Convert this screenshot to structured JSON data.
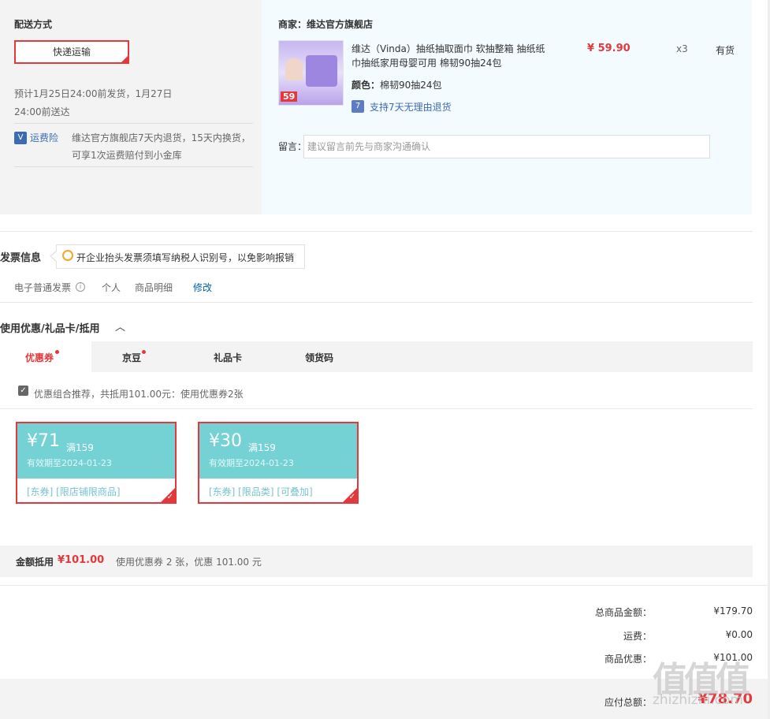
{
  "delivery": {
    "title": "配送方式",
    "method": "快递运输",
    "estimate_line1": "预计1月25日24:00前发货，1月27日",
    "estimate_line2": "24:00前送达",
    "insurance_badge": "V",
    "insurance_label": "运费险",
    "insurance_text1": "维达官方旗舰店7天内退货，15天内换货，",
    "insurance_text2": "可享1次运费赔付到小金库"
  },
  "merchant": {
    "label": "商家：维达官方旗舰店",
    "product_title1": "维达（Vinda）抽纸抽取面巾 软抽整箱 抽纸纸",
    "product_title2": "巾抽纸家用母婴可用 棉韧90抽24包",
    "image_badge": "59",
    "price": "¥ 59.90",
    "qty": "x3",
    "stock": "有货",
    "color_label": "颜色：",
    "color_value": "棉韧90抽24包",
    "return_icon": "7",
    "return_policy": "支持7天无理由退货",
    "message_label": "留言：",
    "message_placeholder": "建议留言前先与商家沟通确认"
  },
  "invoice": {
    "title": "发票信息",
    "tip": "开企业抬头发票须填写纳税人识别号，以免影响报销",
    "type": "电子普通发票",
    "info_glyph": "i",
    "holder": "个人",
    "content": "商品明细",
    "edit": "修改"
  },
  "coupons": {
    "title": "使用优惠/礼品卡/抵用",
    "toggle_glyph": "︿",
    "tabs": [
      "优惠券",
      "京豆",
      "礼品卡",
      "领货码"
    ],
    "recommend_text": "优惠组合推荐，共抵用101.00元：使用优惠券2张",
    "cards": [
      {
        "amount": "¥71",
        "condition": "满159",
        "valid": "有效期至2024-01-23",
        "tags": "[东券]  [限店铺限商品]"
      },
      {
        "amount": "¥30",
        "condition": "满159",
        "valid": "有效期至2024-01-23",
        "tags": "[东券]  [限品类]  [可叠加]"
      }
    ],
    "summary_label": "金额抵用",
    "summary_amount": "¥101.00",
    "summary_desc": "使用优惠券 2 张，优惠 101.00 元"
  },
  "totals": {
    "goods_label": "总商品金额：",
    "goods_value": "¥179.70",
    "shipping_label": "运费：",
    "shipping_value": "¥0.00",
    "discount_label": "商品优惠：",
    "discount_value": "¥101.00",
    "payable_label": "应付总额：",
    "payable_value": "¥78.70"
  },
  "watermark": {
    "main": "值值值",
    "sub": "zhizhizhi.com"
  },
  "colors": {
    "accent": "#e4393c",
    "coupon": "#74d2d5",
    "link": "#3c6bb3"
  }
}
